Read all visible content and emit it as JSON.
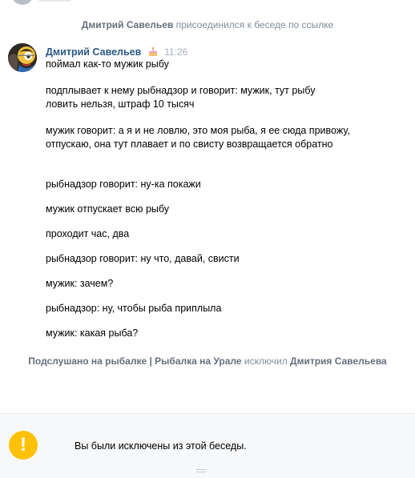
{
  "service": {
    "join": {
      "actor": "Дмитрий Савельев",
      "text": "присоединился к беседе по ссылке"
    },
    "kick": {
      "actor": "Подслушано на рыбалке | Рыбалка на Урале",
      "text": "исключил",
      "target": "Дмитрия Савельева"
    }
  },
  "message": {
    "author": "Дмитрий Савельев",
    "time": "11:26",
    "badge_icon": "cake-icon",
    "lines": [
      "поймал как-то мужик рыбу",
      "подплывает к нему рыбнадзор и говорит: мужик, тут рыбу ловить нельзя, штраф 10 тысяч",
      "мужик говорит: а я и не ловлю, это моя рыба, я ее сюда привожу, отпускаю, она тут плавает и по свисту возвращается обратно",
      "рыбнадзор говорит: ну-ка покажи",
      "мужик отпускает всю рыбу",
      "проходит час, два",
      "рыбнадзор говорит: ну что, давай, свисти",
      "мужик: зачем?",
      "рыбнадзор: ну, чтобы рыба приплыла",
      "мужик: какая рыба?"
    ]
  },
  "composer": {
    "icon": "warning-icon",
    "icon_glyph": "!",
    "text": "Вы были исключены из этой беседы."
  },
  "colors": {
    "author_link": "#2a5885",
    "service_text": "#818c99",
    "warning": "#ffc107",
    "composer_bg": "#f7f8fa"
  }
}
